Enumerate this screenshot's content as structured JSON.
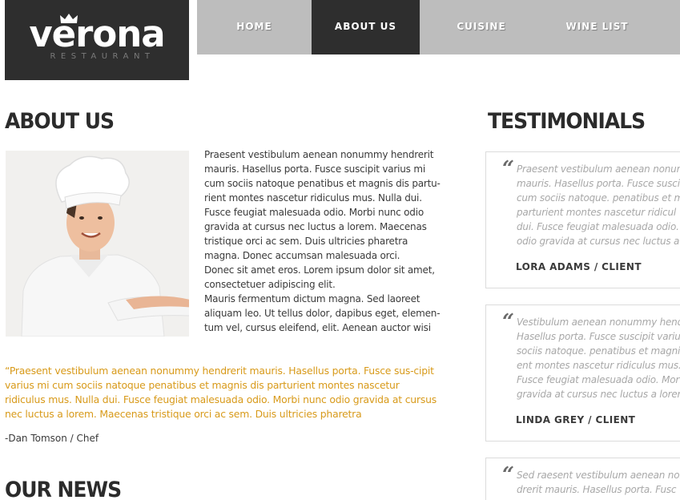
{
  "logo": {
    "name": "verona",
    "subtitle": "RESTAURANT",
    "icon": "crown-icon"
  },
  "nav": {
    "items": [
      {
        "label": "HOME",
        "active": false
      },
      {
        "label": "ABOUT US",
        "active": true
      },
      {
        "label": "CUISINE",
        "active": false
      },
      {
        "label": "WINE LIST",
        "active": false
      }
    ]
  },
  "about": {
    "heading": "ABOUT US",
    "photo_alt": "chef-photo",
    "paragraphs": [
      "Praesent vestibulum aenean nonummy hendrerit mauris. Hasellus porta. Fusce suscipit varius mi cum sociis natoque penatibus et magnis dis partu-rient montes nascetur ridiculus mus. Nulla dui. Fusce feugiat malesuada odio. Morbi nunc odio gravida at cursus nec luctus a lorem. Maecenas tristique orci ac sem. Duis ultricies pharetra magna. Donec accumsan malesuada orci.",
      "Donec sit amet eros. Lorem ipsum dolor sit amet, consectetuer adipiscing elit.",
      "Mauris fermentum dictum magna. Sed laoreet aliquam leo. Ut tellus dolor, dapibus eget, elemen-tum vel, cursus eleifend, elit. Aenean auctor wisi"
    ],
    "quote": "“Praesent vestibulum aenean nonummy hendrerit mauris. Hasellus porta. Fusce sus-cipit varius mi cum sociis natoque penatibus et magnis dis parturient montes nascetur ridiculus mus. Nulla dui. Fusce feugiat malesuada odio. Morbi nunc odio gravida at cursus nec luctus a lorem. Maecenas tristique orci ac sem. Duis ultricies pharetra",
    "quote_author": "-Dan Tomson / Chef"
  },
  "news": {
    "heading": "OUR NEWS"
  },
  "testimonials": {
    "heading": "TESTIMONIALS",
    "items": [
      {
        "lines": [
          "Praesent vestibulum aenean nonum",
          "mauris. Hasellus porta. Fusce susci",
          "cum sociis natoque. penatibus et m",
          "parturient montes nascetur ridicul",
          "dui. Fusce feugiat malesuada odio.",
          "odio gravida at cursus nec luctus a"
        ],
        "author": "LORA ADAMS / CLIENT"
      },
      {
        "lines": [
          "Vestibulum aenean nonummy hend",
          "Hasellus porta. Fusce suscipit variu",
          "sociis natoque. penatibus et magni",
          "ent montes nascetur ridiculus mus.",
          "Fusce feugiat malesuada odio. Mor",
          "gravida at cursus nec luctus a lorem"
        ],
        "author": "LINDA GREY / CLIENT"
      },
      {
        "lines": [
          "Sed raesent vestibulum aenean non",
          "drerit mauris. Hasellus porta. Fusc"
        ],
        "author": ""
      }
    ]
  },
  "colors": {
    "dark": "#2e2e2e",
    "nav_bg": "#bdbdbd",
    "quote_accent": "#d89a1a"
  }
}
